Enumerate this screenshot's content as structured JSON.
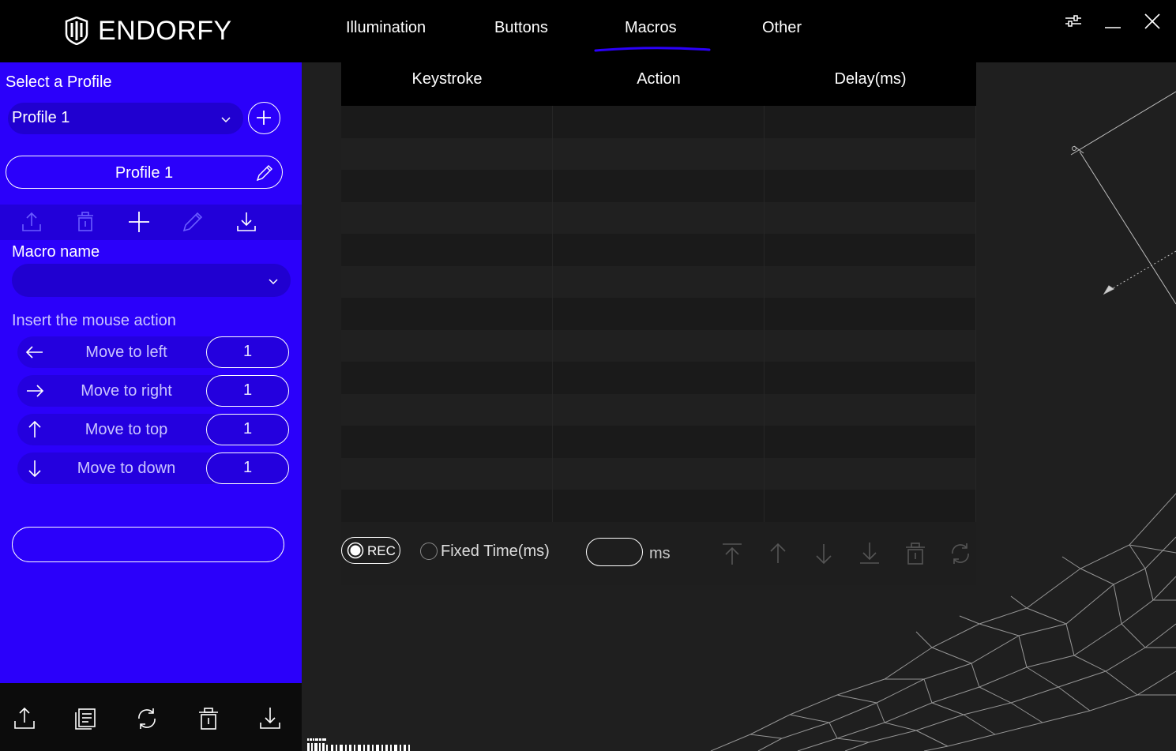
{
  "brand": {
    "name": "ENDORFY"
  },
  "nav": {
    "tabs": [
      {
        "label": "Illumination",
        "active": false
      },
      {
        "label": "Buttons",
        "active": false
      },
      {
        "label": "Macros",
        "active": true
      },
      {
        "label": "Other",
        "active": false
      }
    ],
    "accent": "#2b00fa"
  },
  "window_controls": [
    "settings-sliders-icon",
    "minimize-icon",
    "close-icon"
  ],
  "sidebar": {
    "select_profile_label": "Select a Profile",
    "profile_selected": "Profile 1",
    "profile_name": "Profile 1",
    "macro_toolbar_icons": [
      "export-icon",
      "delete-icon",
      "add-icon",
      "edit-icon",
      "import-icon"
    ],
    "macro_name_label": "Macro name",
    "macro_selected": "",
    "mouse_action_label": "Insert the mouse action",
    "move_actions": [
      {
        "label": "Move to left",
        "icon": "arrow-left-icon",
        "value": "1"
      },
      {
        "label": "Move to right",
        "icon": "arrow-right-icon",
        "value": "1"
      },
      {
        "label": "Move to top",
        "icon": "arrow-up-icon",
        "value": "1"
      },
      {
        "label": "Move to down",
        "icon": "arrow-down-icon",
        "value": "1"
      }
    ],
    "text_field_value": "",
    "bottom_icons": [
      "export-icon",
      "copy-icon",
      "reset-icon",
      "delete-icon",
      "import-icon"
    ],
    "background": "#2b00fa"
  },
  "macro_table": {
    "columns": [
      "Keystroke",
      "Action",
      "Delay(ms)"
    ],
    "rows": []
  },
  "recording": {
    "rec_label": "REC",
    "rec_selected": true,
    "fixed_time_label": "Fixed Time(ms)",
    "fixed_time_selected": false,
    "ms_value": "",
    "ms_unit": "ms",
    "toolbar_icons": [
      "move-to-top-icon",
      "move-up-icon",
      "move-down-icon",
      "move-to-bottom-icon",
      "delete-icon",
      "refresh-icon"
    ]
  }
}
